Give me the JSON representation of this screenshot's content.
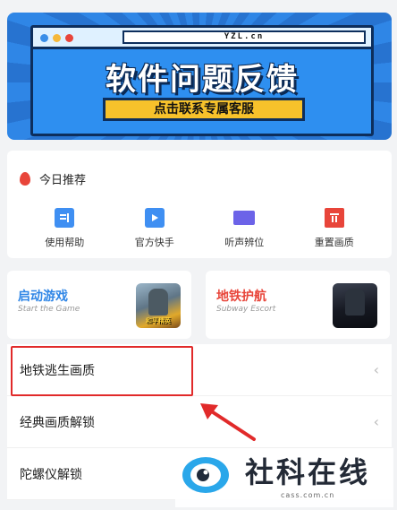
{
  "banner": {
    "url": "YZL.cn",
    "headline": "软件问题反馈",
    "cta": "点击联系专属客服"
  },
  "recommend": {
    "title": "今日推荐",
    "items": [
      {
        "label": "使用帮助",
        "icon": "document-icon"
      },
      {
        "label": "官方快手",
        "icon": "play-icon"
      },
      {
        "label": "听声辨位",
        "icon": "monitor-icon"
      },
      {
        "label": "重置画质",
        "icon": "trash-icon"
      }
    ]
  },
  "games": [
    {
      "title": "启动游戏",
      "subtitle": "Start the Game",
      "title_color": "#2f86e6",
      "thumb_text": "和平精英"
    },
    {
      "title": "地铁护航",
      "subtitle": "Subway Escort",
      "title_color": "#e8453a"
    }
  ],
  "list": [
    {
      "label": "地铁逃生画质"
    },
    {
      "label": "经典画质解锁"
    },
    {
      "label": "陀螺仪解锁"
    }
  ],
  "watermark": {
    "text": "社科在线",
    "url": "cass.com.cn"
  },
  "colors": {
    "accent_blue": "#2f86e6",
    "accent_red": "#e8453a",
    "highlight": "#e12a2a"
  }
}
